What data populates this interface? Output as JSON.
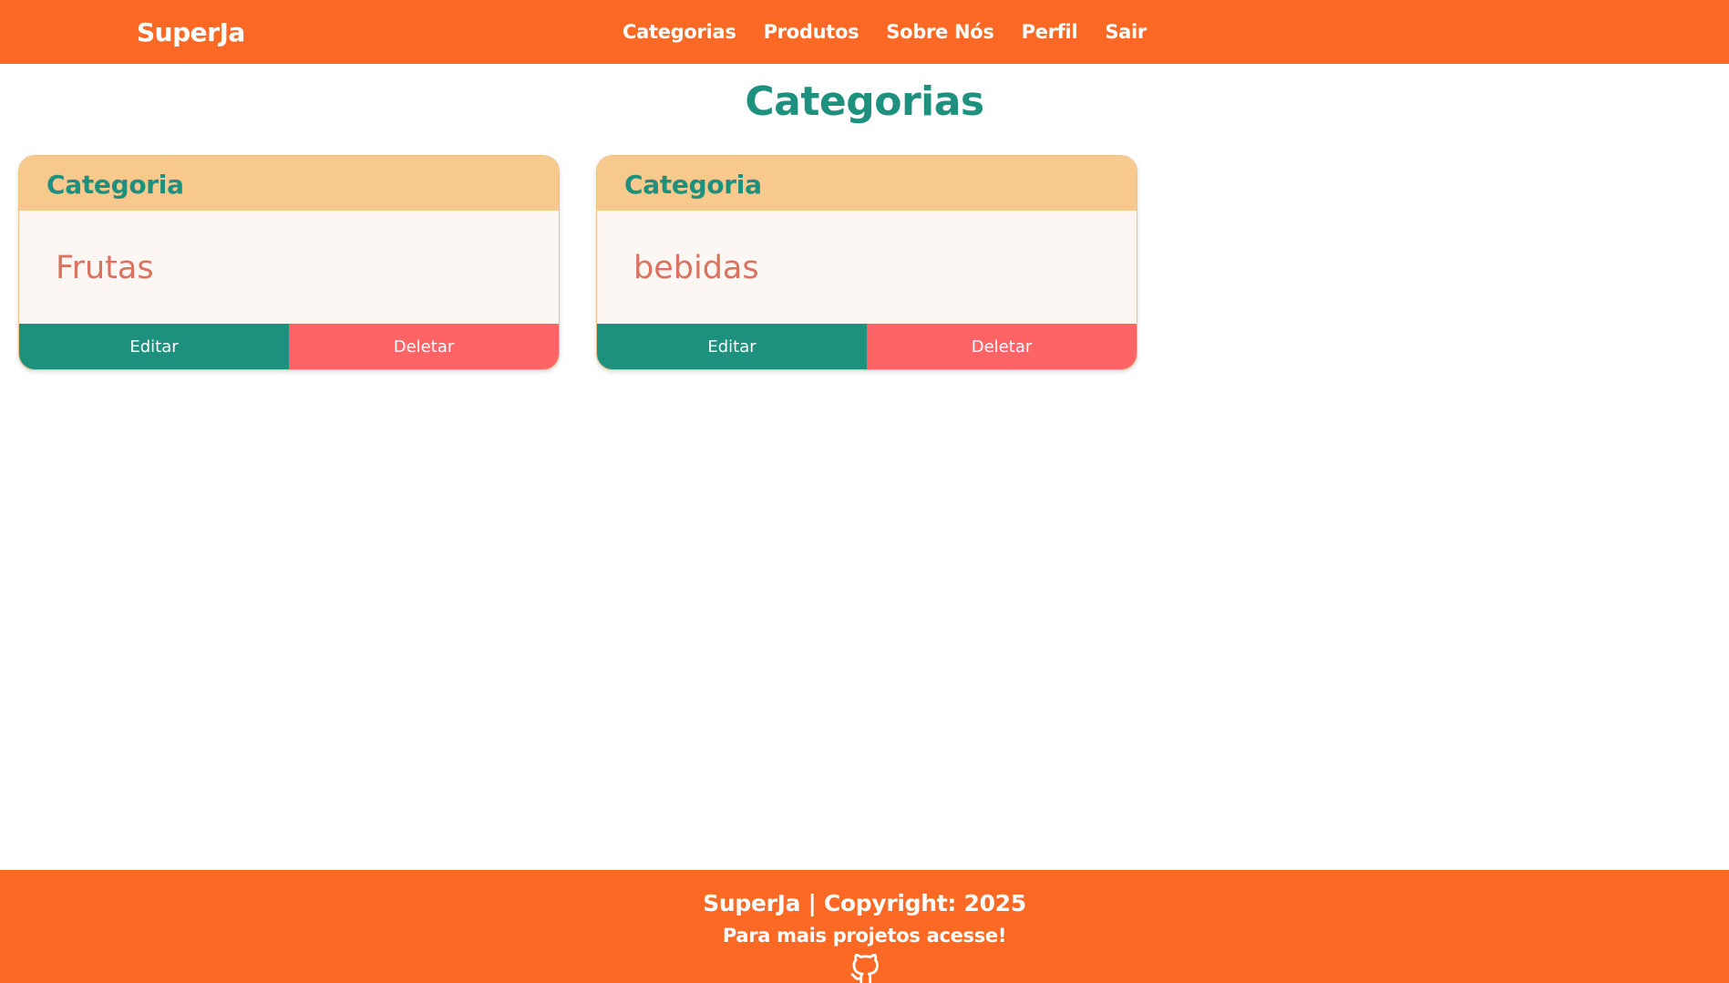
{
  "navbar": {
    "brand": "SuperJa",
    "links": [
      {
        "label": "Categorias"
      },
      {
        "label": "Produtos"
      },
      {
        "label": "Sobre Nós"
      },
      {
        "label": "Perfil"
      },
      {
        "label": "Sair"
      }
    ]
  },
  "main": {
    "title": "Categorias",
    "cards": [
      {
        "header": "Categoria",
        "name": "Frutas",
        "edit_label": "Editar",
        "delete_label": "Deletar"
      },
      {
        "header": "Categoria",
        "name": "bebidas",
        "edit_label": "Editar",
        "delete_label": "Deletar"
      }
    ]
  },
  "footer": {
    "copyright": "SuperJa | Copyright: 2025",
    "cta": "Para mais projetos acesse!",
    "icon": "github-icon"
  },
  "colors": {
    "primary_orange": "#FC6924",
    "teal": "#1E917E",
    "card_header": "#F7C98D",
    "card_body": "#FDF7F4",
    "category_text": "#D9735F",
    "delete_red": "#FE6366"
  }
}
